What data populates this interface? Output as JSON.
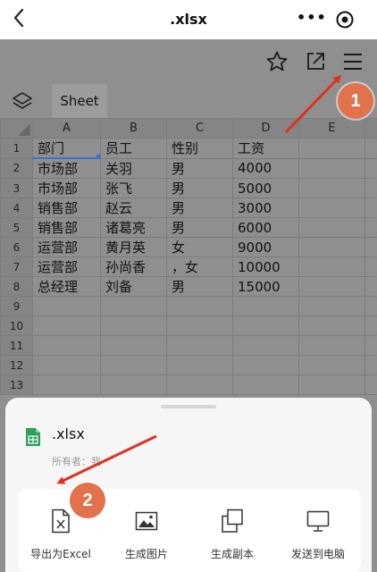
{
  "window": {
    "title": ".xlsx"
  },
  "capsule": {
    "more": "•••"
  },
  "sheet_tab": "Sheet",
  "columns": [
    "A",
    "B",
    "C",
    "D",
    "E"
  ],
  "rows": [
    {
      "n": "1",
      "cells": [
        "部门",
        "员工",
        "性别",
        "工资",
        ""
      ]
    },
    {
      "n": "2",
      "cells": [
        "市场部",
        "关羽",
        "男",
        "4000",
        ""
      ]
    },
    {
      "n": "3",
      "cells": [
        "市场部",
        "张飞",
        "男",
        "5000",
        ""
      ]
    },
    {
      "n": "4",
      "cells": [
        "销售部",
        "赵云",
        "男",
        "3000",
        ""
      ]
    },
    {
      "n": "5",
      "cells": [
        "销售部",
        "诸葛亮",
        "男",
        "6000",
        ""
      ]
    },
    {
      "n": "6",
      "cells": [
        "运营部",
        "黄月英",
        "女",
        "9000",
        ""
      ]
    },
    {
      "n": "7",
      "cells": [
        "运营部",
        "孙尚香",
        "，女",
        "10000",
        ""
      ]
    },
    {
      "n": "8",
      "cells": [
        "总经理",
        "刘备",
        "男",
        "15000",
        ""
      ]
    },
    {
      "n": "9",
      "cells": [
        "",
        "",
        "",
        "",
        ""
      ]
    },
    {
      "n": "10",
      "cells": [
        "",
        "",
        "",
        "",
        ""
      ]
    },
    {
      "n": "11",
      "cells": [
        "",
        "",
        "",
        "",
        ""
      ]
    },
    {
      "n": "12",
      "cells": [
        "",
        "",
        "",
        "",
        ""
      ]
    },
    {
      "n": "13",
      "cells": [
        "",
        "",
        "",
        "",
        ""
      ]
    }
  ],
  "panel": {
    "file_name": ".xlsx",
    "owner": "所有者：我",
    "actions": [
      {
        "label": "导出为Excel",
        "icon": "excel-file-icon"
      },
      {
        "label": "生成图片",
        "icon": "image-icon"
      },
      {
        "label": "生成副本",
        "icon": "copy-icon"
      },
      {
        "label": "发送到电脑",
        "icon": "monitor-icon"
      }
    ]
  },
  "annotations": [
    {
      "label": "1"
    },
    {
      "label": "2"
    }
  ],
  "colors": {
    "annotation_badge": "#e2724c",
    "annotation_arrow": "#e03020",
    "selection": "#3b6fd8",
    "file_icon": "#2aa05a"
  },
  "icons": [
    "back-icon",
    "more-icon",
    "target-icon",
    "star-icon",
    "share-icon",
    "menu-icon",
    "layers-icon",
    "xlsx-file-icon",
    "excel-file-icon",
    "image-icon",
    "copy-icon",
    "monitor-icon"
  ]
}
